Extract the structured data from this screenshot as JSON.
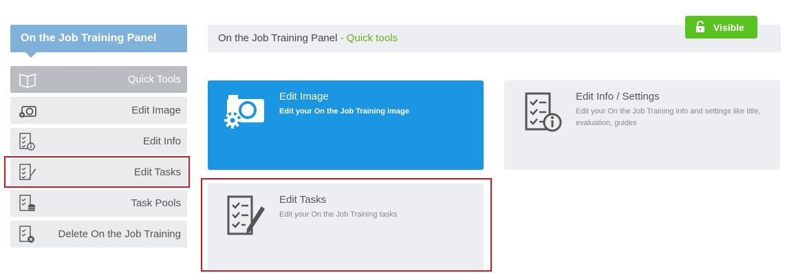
{
  "sidebar": {
    "title": "On the Job Training Panel",
    "items": [
      {
        "label": "Quick Tools",
        "icon": "book-icon"
      },
      {
        "label": "Edit Image",
        "icon": "camera-gear-icon"
      },
      {
        "label": "Edit Info",
        "icon": "checklist-info-icon"
      },
      {
        "label": "Edit Tasks",
        "icon": "checklist-pen-icon"
      },
      {
        "label": "Task Pools",
        "icon": "checklist-database-icon"
      },
      {
        "label": "Delete On the Job Training",
        "icon": "checklist-delete-icon"
      }
    ]
  },
  "header": {
    "title": "On the Job Training Panel",
    "separator": " - ",
    "subtitle": "Quick tools",
    "visible_label": "Visible"
  },
  "tiles": {
    "edit_image": {
      "title": "Edit Image",
      "desc": "Edit your On the Job Training image"
    },
    "edit_info": {
      "title": "Edit Info / Settings",
      "desc": "Edit your On the Job Training info and settings like title, evaluation, guides"
    },
    "edit_tasks": {
      "title": "Edit Tasks",
      "desc": "Edit your On the Job Training tasks"
    }
  },
  "colors": {
    "sidebar_title_bg": "#7eb2da",
    "accent_green": "#67b21d",
    "visible_button": "#58c21e",
    "primary_tile": "#1a96e2",
    "highlight": "#d9161c"
  }
}
